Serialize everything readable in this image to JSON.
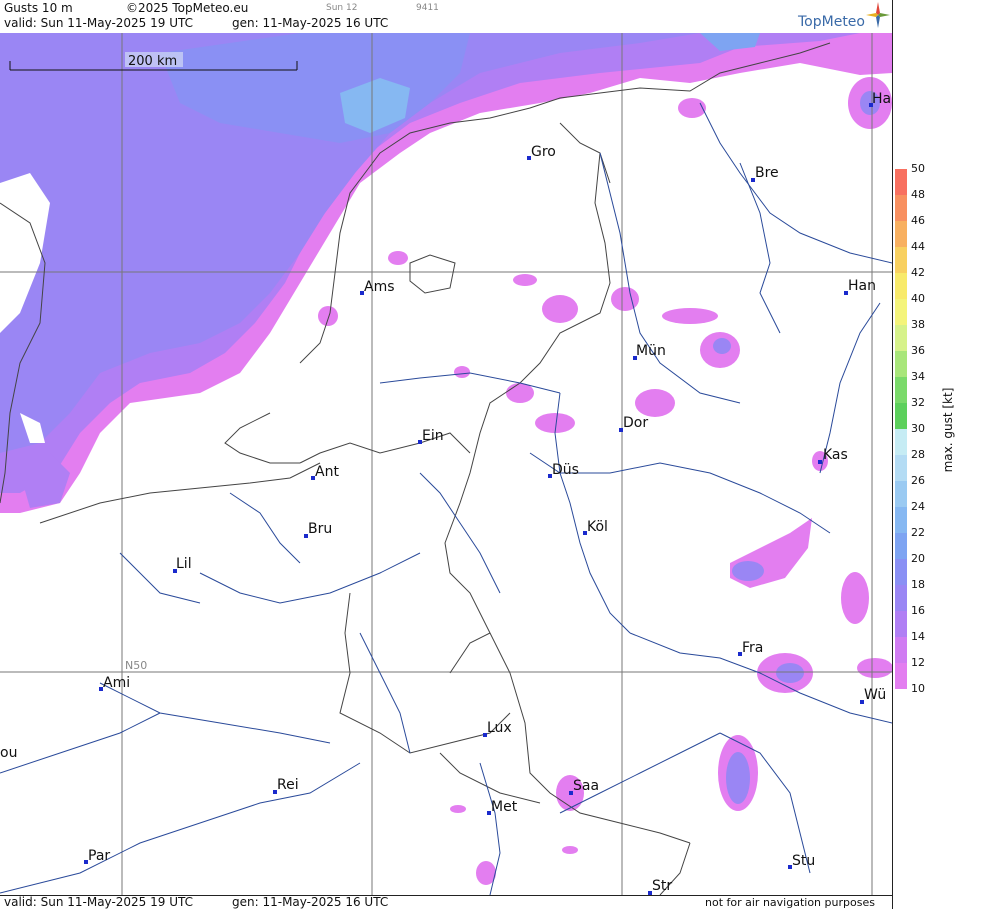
{
  "header": {
    "product": "Gusts 10 m",
    "copyright": "©2025 TopMeteo.eu",
    "day": "Sun 12",
    "code": "9411",
    "valid": "valid:  Sun  11-May-2025  19 UTC",
    "gen": "gen: 11-May-2025 16 UTC",
    "brand": "TopMeteo"
  },
  "footer": {
    "valid": "valid:  Sun  11-May-2025  19 UTC",
    "gen": "gen: 11-May-2025 16 UTC",
    "disclaimer": "not for air navigation purposes"
  },
  "map": {
    "scale_label": "200 km",
    "lat_label": "N50",
    "cities": [
      {
        "name": "Gro"
      },
      {
        "name": "Bre"
      },
      {
        "name": "Ha"
      },
      {
        "name": "Ams"
      },
      {
        "name": "Han"
      },
      {
        "name": "Mün"
      },
      {
        "name": "Dor"
      },
      {
        "name": "Ein"
      },
      {
        "name": "Kas"
      },
      {
        "name": "Ant"
      },
      {
        "name": "Düs"
      },
      {
        "name": "Bru"
      },
      {
        "name": "Köl"
      },
      {
        "name": "Lil"
      },
      {
        "name": "Fra"
      },
      {
        "name": "Ami"
      },
      {
        "name": "Wü"
      },
      {
        "name": "Lux"
      },
      {
        "name": "ou"
      },
      {
        "name": "Rei"
      },
      {
        "name": "Saa"
      },
      {
        "name": "Met"
      },
      {
        "name": "Par"
      },
      {
        "name": "Stu"
      },
      {
        "name": "Str"
      }
    ]
  },
  "colorbar": {
    "title": "max. gust [kt]",
    "ticks": [
      "50",
      "48",
      "46",
      "44",
      "42",
      "40",
      "38",
      "36",
      "34",
      "32",
      "30",
      "28",
      "26",
      "24",
      "22",
      "20",
      "18",
      "16",
      "14",
      "12",
      "10"
    ],
    "colors": {
      "10": "#ffffff",
      "12": "#e37ef0",
      "14": "#d07cf2",
      "16": "#b07ff4",
      "18": "#9a86f4",
      "20": "#8a90f4",
      "22": "#7ea4f2",
      "24": "#86b8f2",
      "26": "#9acaf2",
      "28": "#b4dcf4",
      "30": "#c6ecf4",
      "32": "#5cd05c",
      "34": "#7ada6a",
      "36": "#a8e67a",
      "38": "#d6f28a",
      "40": "#f4f47a",
      "42": "#f8ea6a",
      "44": "#f8d060",
      "46": "#f8b060",
      "48": "#f89060",
      "50": "#f87060"
    }
  }
}
